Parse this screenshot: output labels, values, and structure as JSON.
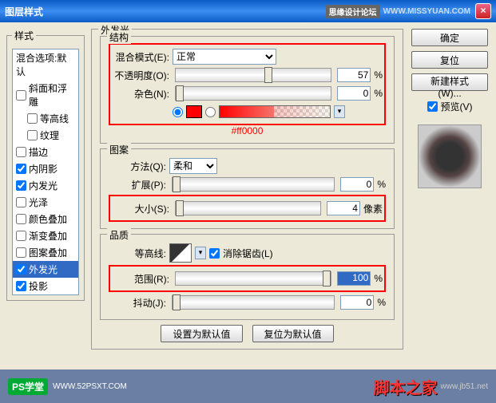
{
  "title": "图层样式",
  "header_tag": "思缘设计论坛",
  "header_url": "WWW.MISSYUAN.COM",
  "sidebar": {
    "legend": "样式",
    "blend_default": "混合选项:默认",
    "items": [
      {
        "label": "斜面和浮雕",
        "checked": false
      },
      {
        "label": "等高线",
        "checked": false,
        "indent": true
      },
      {
        "label": "纹理",
        "checked": false,
        "indent": true
      },
      {
        "label": "描边",
        "checked": false
      },
      {
        "label": "内阴影",
        "checked": true
      },
      {
        "label": "内发光",
        "checked": true
      },
      {
        "label": "光泽",
        "checked": false
      },
      {
        "label": "颜色叠加",
        "checked": false
      },
      {
        "label": "渐变叠加",
        "checked": false
      },
      {
        "label": "图案叠加",
        "checked": false
      },
      {
        "label": "外发光",
        "checked": true,
        "selected": true
      },
      {
        "label": "投影",
        "checked": true
      }
    ]
  },
  "main": {
    "title": "外发光",
    "structure": {
      "legend": "结构",
      "blend_mode_label": "混合模式(E):",
      "blend_mode_value": "正常",
      "opacity_label": "不透明度(O):",
      "opacity_value": "57",
      "noise_label": "杂色(N):",
      "noise_value": "0",
      "pct": "%",
      "color_hex": "#ff0000"
    },
    "elements": {
      "legend": "图案",
      "technique_label": "方法(Q):",
      "technique_value": "柔和",
      "spread_label": "扩展(P):",
      "spread_value": "0",
      "size_label": "大小(S):",
      "size_value": "4",
      "size_unit": "像素",
      "pct": "%"
    },
    "quality": {
      "legend": "品质",
      "contour_label": "等高线:",
      "anti_alias": "消除锯齿(L)",
      "range_label": "范围(R):",
      "range_value": "100",
      "jitter_label": "抖动(J):",
      "jitter_value": "0",
      "pct": "%"
    },
    "defaults_set": "设置为默认值",
    "defaults_reset": "复位为默认值"
  },
  "buttons": {
    "ok": "确定",
    "cancel": "复位",
    "new_style": "新建样式(W)...",
    "preview": "预览(V)"
  },
  "footer": {
    "logo": "PS学堂",
    "url": "WWW.52PSXT.COM",
    "brand": "脚本之家",
    "brand_url": "www.jb51.net"
  }
}
